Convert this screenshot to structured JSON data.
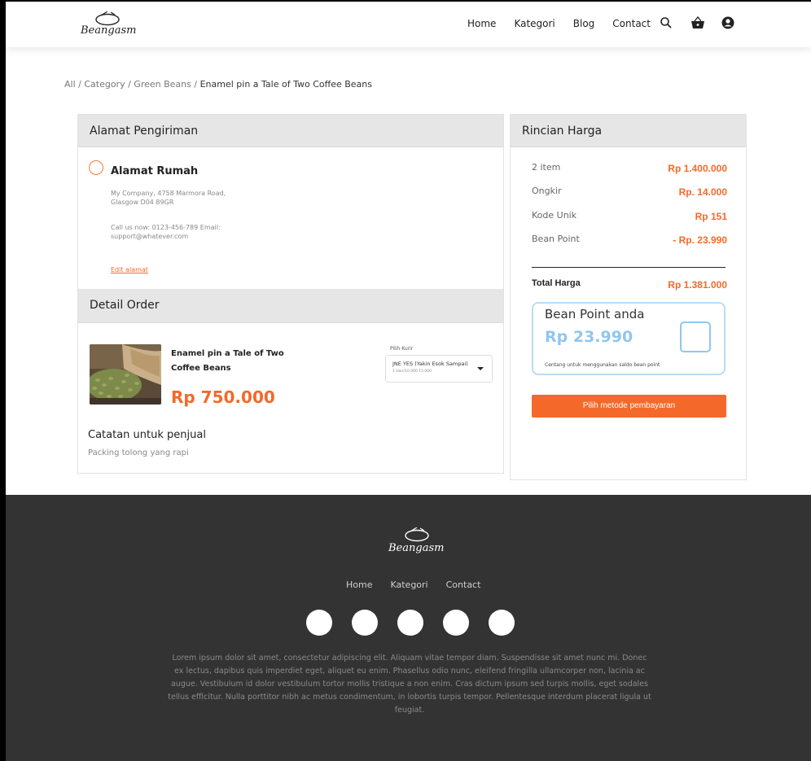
{
  "nav": {
    "brand": "Beangasm",
    "links": [
      "Home",
      "Kategori",
      "Blog",
      "Contact"
    ],
    "icons": [
      "search-icon",
      "basket-icon",
      "user-icon"
    ]
  },
  "breadcrumb": {
    "items": [
      "All",
      "Category",
      "Green Beans"
    ],
    "current": "Enamel pin a Tale of Two Coffee Beans"
  },
  "shipping": {
    "header": "Alamat Pengiriman",
    "address_title": "Alamat Rumah",
    "address_lines": [
      "My Company, 4758 Marmora Road,",
      "Glasgow D04 89GR"
    ],
    "contact_lines": [
      "Call us now: 0123-456-789 Email:",
      "support@whatever.com"
    ],
    "edit_label": "Edit alamat"
  },
  "order": {
    "header": "Detail Order",
    "product_name": "Enamel pin a Tale of Two Coffee Beans",
    "product_price": "Rp 750.000",
    "courier_label": "Pilih Kurir",
    "courier_selected": "JNE YES (Yakin Esok Sampai)",
    "courier_sub": "1 Hari/10.000 15.000",
    "note_title": "Catatan untuk penjual",
    "note_text": "Packing tolong yang rapi"
  },
  "summary": {
    "header": "Rincian Harga",
    "rows": [
      {
        "label": "2 item",
        "value": "Rp 1.400.000"
      },
      {
        "label": "Ongkir",
        "value": "Rp. 14.000"
      },
      {
        "label": "Kode Unik",
        "value": "Rp 151"
      },
      {
        "label": "Bean Point",
        "value": "- Rp. 23.990"
      }
    ],
    "total_label": "Total Harga",
    "total_value": "Rp 1.381.000",
    "bean_point_title": "Bean Point anda",
    "bean_point_value": "Rp 23.990",
    "bean_point_note": "Centang untuk menggunakan saldo bean point",
    "pay_button": "Pilih metode pembayaran"
  },
  "footer": {
    "brand": "Beangasm",
    "links": [
      "Home",
      "Kategori",
      "Contact"
    ],
    "social_count": 5,
    "text": "Lorem ipsum dolor sit amet, consectetur adipiscing elit. Aliquam vitae tempor diam. Suspendisse sit amet nunc mi. Donec ex lectus, dapibus quis imperdiet eget, aliquet eu enim. Phasellus odio nunc, eleifend fringilla ullamcorper non, lacinia ac augue. Vestibulum id dolor vestibulum tortor mollis tristique a non enim. Cras dictum ipsum sed turpis mollis, eget sodales tellus efficitur. Nulla porttitor nibh ac metus condimentum, in lobortis turpis tempor. Pellentesque interdum placerat ligula ut feugiat."
  },
  "colors": {
    "accent": "#f4692a",
    "bean_point": "#8fc7ef",
    "footer_bg": "#333333"
  }
}
